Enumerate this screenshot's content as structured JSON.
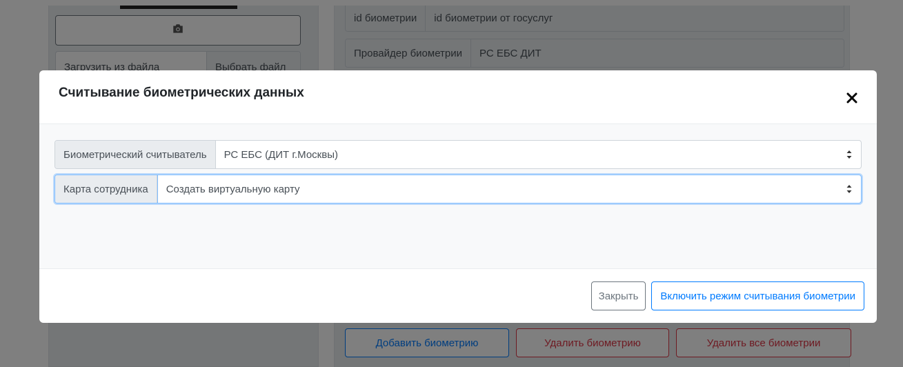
{
  "background": {
    "upload": {
      "file_label": "Загрузить из файла",
      "file_button": "Выбрать файл"
    },
    "fields": [
      {
        "label": "id биометрии",
        "value": "id биометрии от госуслуг"
      },
      {
        "label": "Провайдер биометрии",
        "value": "РС ЕБС ДИТ"
      }
    ],
    "buttons": {
      "add": "Добавить биометрию",
      "delete": "Удалить биометрию",
      "delete_all": "Удалить все биометрии"
    }
  },
  "modal": {
    "title": "Считывание биометрических данных",
    "reader": {
      "label": "Биометрический считыватель",
      "value": "РС ЕБС (ДИТ г.Москвы)"
    },
    "card": {
      "label": "Карта сотрудника",
      "value": "Создать виртуальную карту"
    },
    "footer": {
      "close": "Закрыть",
      "enable": "Включить режим считывания биометрии"
    }
  },
  "colors": {
    "primary": "#007bff",
    "danger": "#dc3545",
    "secondary": "#6c757d"
  }
}
